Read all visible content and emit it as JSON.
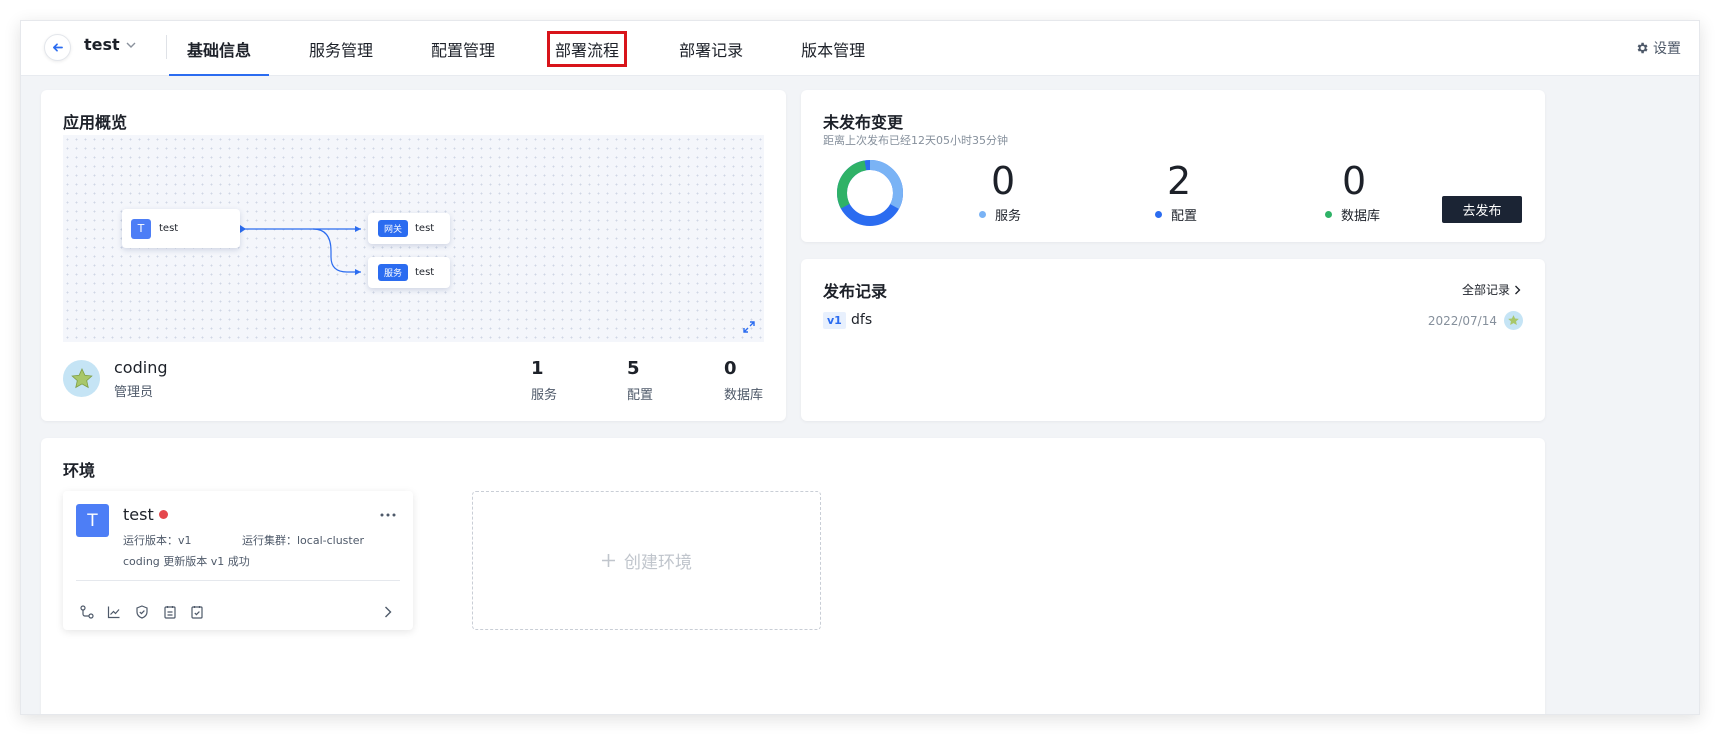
{
  "header": {
    "app_name": "test",
    "tabs": [
      "基础信息",
      "服务管理",
      "配置管理",
      "部署流程",
      "部署记录",
      "版本管理"
    ],
    "active_tab": "基础信息",
    "highlighted_tab": "部署流程",
    "settings_label": "设置"
  },
  "overview": {
    "title": "应用概览",
    "nodes": {
      "source": "test",
      "gateway_tag": "网关",
      "gateway_name": "test",
      "service_tag": "服务",
      "service_name": "test"
    },
    "owner": {
      "name": "coding",
      "role": "管理员"
    },
    "stats": [
      {
        "value": "1",
        "label": "服务"
      },
      {
        "value": "5",
        "label": "配置"
      },
      {
        "value": "0",
        "label": "数据库"
      }
    ]
  },
  "unpublished": {
    "title": "未发布变更",
    "subtitle": "距离上次发布已经12天05小时35分钟",
    "counts": [
      {
        "value": "0",
        "label": "服务",
        "color": "#7ab3f5"
      },
      {
        "value": "2",
        "label": "配置",
        "color": "#2b6cf0"
      },
      {
        "value": "0",
        "label": "数据库",
        "color": "#2fb267"
      }
    ],
    "publish_button": "去发布"
  },
  "release_records": {
    "title": "发布记录",
    "all_link": "全部记录",
    "items": [
      {
        "version": "v1",
        "name": "dfs",
        "date": "2022/07/14"
      }
    ]
  },
  "environments": {
    "title": "环境",
    "card": {
      "avatar_letter": "T",
      "name": "test",
      "run_version": "运行版本：v1",
      "run_cluster": "运行集群：local-cluster",
      "update_text": "coding 更新版本 v1 成功"
    },
    "create_label": "创建环境"
  },
  "colors": {
    "accent": "#2b6cf0",
    "dark_button": "#1b2434",
    "status_red": "#e5484d"
  }
}
